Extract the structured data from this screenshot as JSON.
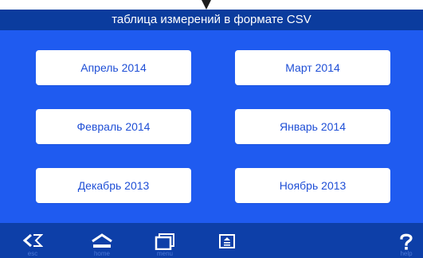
{
  "header": {
    "title": "таблица измерений в формате CSV"
  },
  "months": [
    "Апрель 2014",
    "Март 2014",
    "Февраль 2014",
    "Январь 2014",
    "Декабрь 2013",
    "Ноябрь 2013"
  ],
  "toolbar": {
    "esc_label": "esc",
    "home_label": "home",
    "menu_label": "menu",
    "help_label": "help",
    "icons": {
      "esc": "back-arrow-icon",
      "home": "home-icon",
      "menu": "menu-icon",
      "eject": "eject-icon",
      "help": "help-icon"
    }
  },
  "colors": {
    "header_bg": "#0b3c9e",
    "main_bg": "#1f5bf0",
    "toolbar_bg": "#0d3fa8",
    "button_text": "#1f4fd6"
  }
}
